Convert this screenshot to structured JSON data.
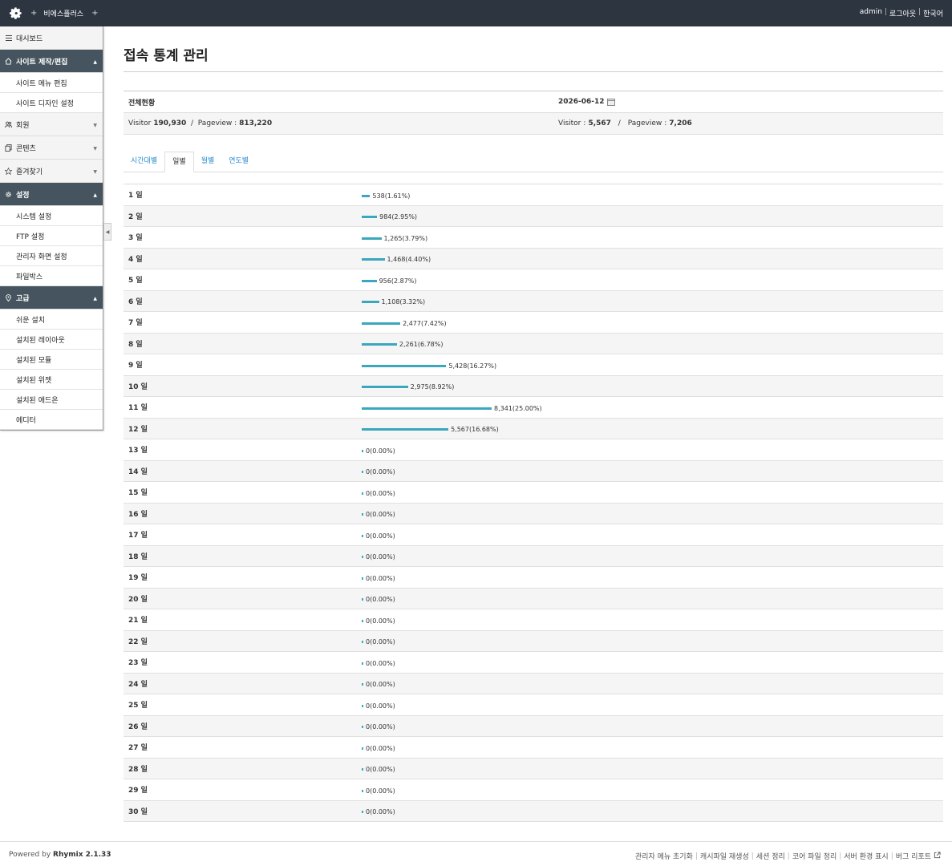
{
  "header": {
    "site_name": "비에스플러스",
    "plus_left": "+",
    "plus_right": "+",
    "user": "admin",
    "logout": "로그아웃",
    "language": "한국어",
    "sep": "|"
  },
  "sidebar": {
    "dashboard": "대시보드",
    "site_build": "사이트 제작/편집",
    "site_build_items": [
      "사이트 메뉴 편집",
      "사이트 디자인 설정"
    ],
    "member": "회원",
    "content": "콘텐츠",
    "favorites": "즐겨찾기",
    "settings": "설정",
    "settings_items": [
      "시스템 설정",
      "FTP 설정",
      "관리자 화면 설정",
      "파일박스"
    ],
    "advanced": "고급",
    "advanced_items": [
      "쉬운 설치",
      "설치된 레이아웃",
      "설치된 모듈",
      "설치된 위젯",
      "설치된 애드온",
      "에디터"
    ]
  },
  "page": {
    "title": "접속 통계 관리",
    "total_label": "전체현황",
    "date": "2026-06-12",
    "visitor_label": "Visitor",
    "pageview_label": "Pageview",
    "total_visitor": "190,930",
    "total_pageview": "813,220",
    "day_visitor": "5,567",
    "day_pageview": "7,206",
    "slash": "/",
    "colon": ":"
  },
  "tabs": [
    "시간대별",
    "일별",
    "월별",
    "연도별"
  ],
  "active_tab": 1,
  "chart_data": {
    "type": "bar",
    "categories": [
      "1 일",
      "2 일",
      "3 일",
      "4 일",
      "5 일",
      "6 일",
      "7 일",
      "8 일",
      "9 일",
      "10 일",
      "11 일",
      "12 일",
      "13 일",
      "14 일",
      "15 일",
      "16 일",
      "17 일",
      "18 일",
      "19 일",
      "20 일",
      "21 일",
      "22 일",
      "23 일",
      "24 일",
      "25 일",
      "26 일",
      "27 일",
      "28 일",
      "29 일",
      "30 일"
    ],
    "values": [
      538,
      984,
      1265,
      1468,
      956,
      1108,
      2477,
      2261,
      5428,
      2975,
      8341,
      5567,
      0,
      0,
      0,
      0,
      0,
      0,
      0,
      0,
      0,
      0,
      0,
      0,
      0,
      0,
      0,
      0,
      0,
      0
    ],
    "labels": [
      "538(1.61%)",
      "984(2.95%)",
      "1,265(3.79%)",
      "1,468(4.40%)",
      "956(2.87%)",
      "1,108(3.32%)",
      "2,477(7.42%)",
      "2,261(6.78%)",
      "5,428(16.27%)",
      "2,975(8.92%)",
      "8,341(25.00%)",
      "5,567(16.68%)",
      "0(0.00%)",
      "0(0.00%)",
      "0(0.00%)",
      "0(0.00%)",
      "0(0.00%)",
      "0(0.00%)",
      "0(0.00%)",
      "0(0.00%)",
      "0(0.00%)",
      "0(0.00%)",
      "0(0.00%)",
      "0(0.00%)",
      "0(0.00%)",
      "0(0.00%)",
      "0(0.00%)",
      "0(0.00%)",
      "0(0.00%)",
      "0(0.00%)"
    ],
    "percents": [
      1.61,
      2.95,
      3.79,
      4.4,
      2.87,
      3.32,
      7.42,
      6.78,
      16.27,
      8.92,
      25.0,
      16.68,
      0,
      0,
      0,
      0,
      0,
      0,
      0,
      0,
      0,
      0,
      0,
      0,
      0,
      0,
      0,
      0,
      0,
      0
    ],
    "bar_color": "#3aa7bd",
    "title": "",
    "xlabel": "",
    "ylabel": ""
  },
  "footer": {
    "powered_prefix": "Powered by",
    "powered_name": "Rhymix 2.1.33",
    "links": [
      "관리자 메뉴 초기화",
      "캐시파일 재생성",
      "세션 정리",
      "코어 파일 정리",
      "서버 환경 표시",
      "버그 리포트"
    ]
  },
  "colors": {
    "header_bg": "#2c3540",
    "sidebar_active_bg": "#45545e",
    "link": "#2a8bd0"
  }
}
